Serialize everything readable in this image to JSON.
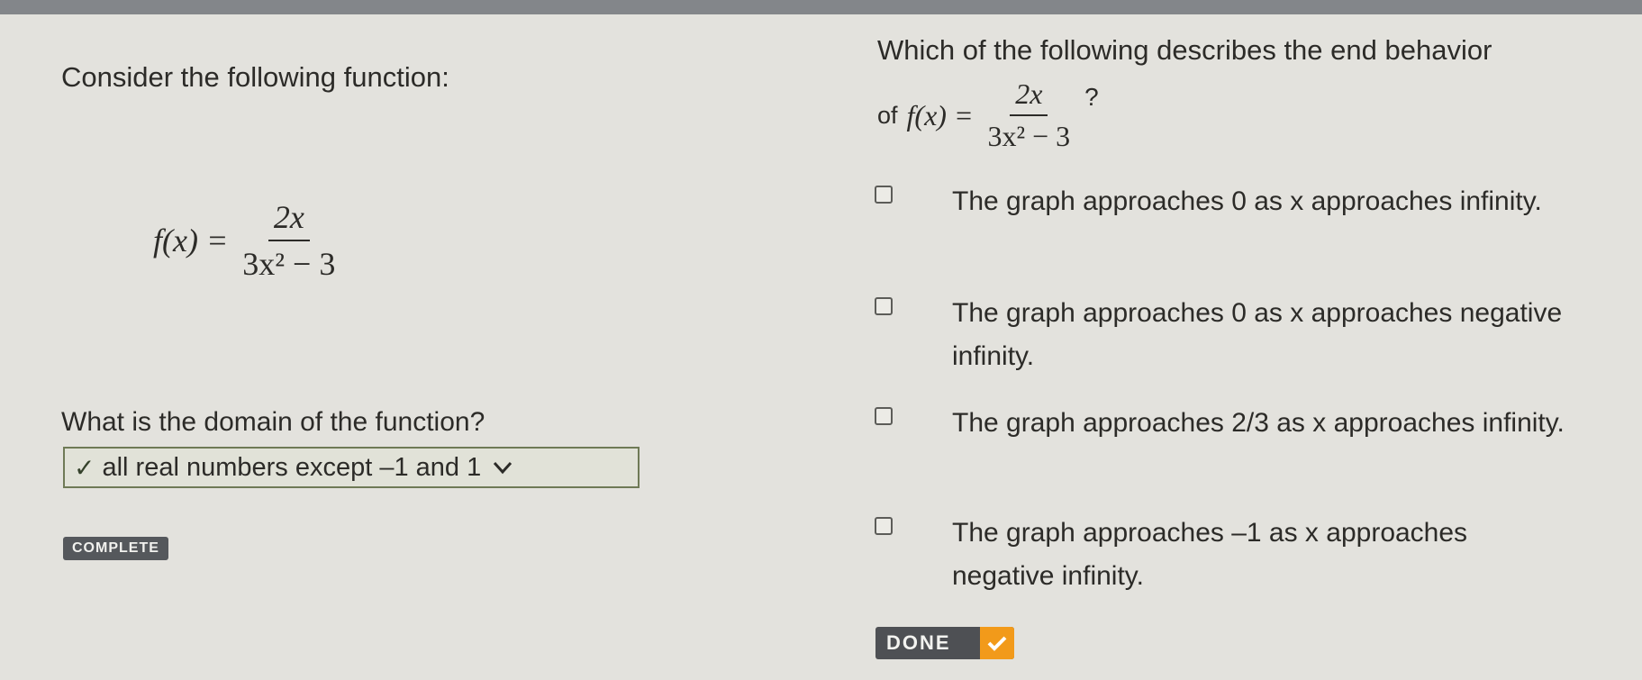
{
  "left": {
    "intro": "Consider the following function:",
    "function": {
      "name": "f(x) =",
      "numerator": "2x",
      "denominator": "3x² − 3"
    },
    "domain_question": "What is the domain of the function?",
    "domain_answer": "all real numbers except –1 and 1",
    "status": "COMPLETE"
  },
  "right": {
    "question": "Which of the following describes the end behavior",
    "question_of": "of",
    "question_mark": "?",
    "function": {
      "name": "f(x) =",
      "numerator": "2x",
      "denominator": "3x² − 3"
    },
    "options": [
      {
        "text": "The graph approaches 0 as x approaches infinity."
      },
      {
        "text": "The graph approaches 0 as x approaches negative infinity."
      },
      {
        "text": "The graph approaches 2/3 as x approaches infinity."
      },
      {
        "text": "The graph approaches –1 as x approaches negative infinity."
      }
    ],
    "done_label": "DONE"
  },
  "colors": {
    "background": "#e3e2dd",
    "accent": "#f29a1a",
    "badge": "#55585c"
  }
}
